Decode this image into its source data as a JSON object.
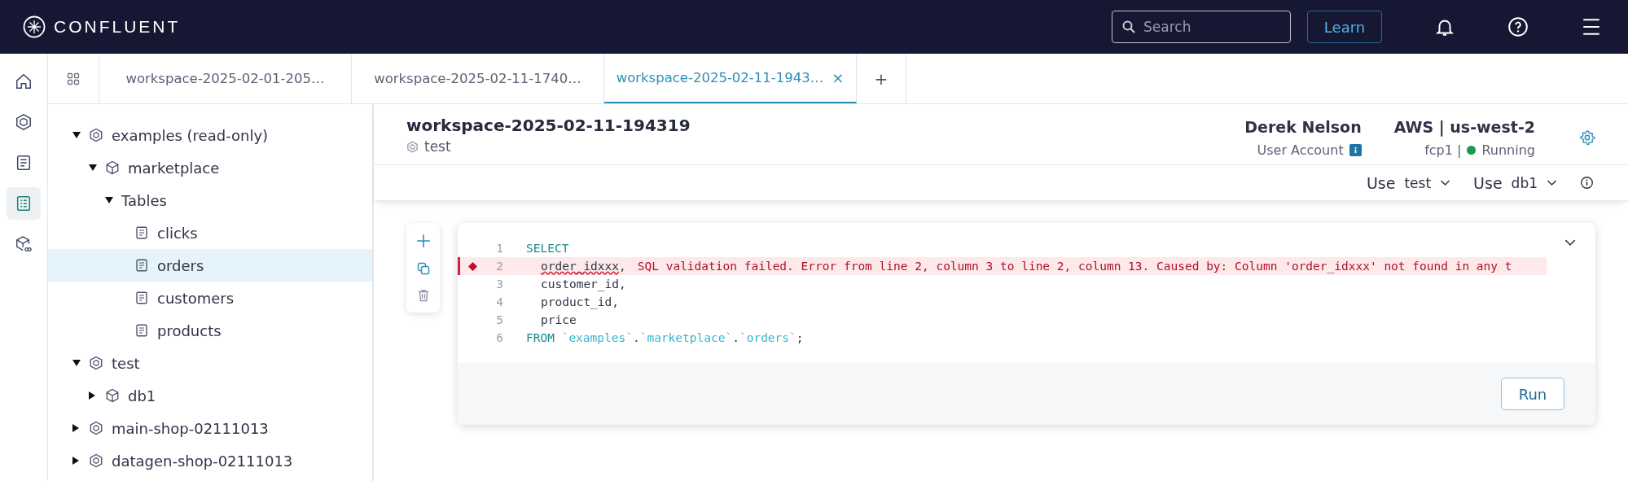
{
  "header": {
    "brand": "CONFLUENT",
    "search": {
      "placeholder": "Search"
    },
    "learn": "Learn"
  },
  "rail": [
    {
      "kind": "home",
      "selected": false
    },
    {
      "kind": "environment",
      "selected": false
    },
    {
      "kind": "document",
      "selected": false
    },
    {
      "kind": "workspace",
      "selected": true
    },
    {
      "kind": "compute",
      "selected": false
    }
  ],
  "tabs": [
    {
      "label": "workspace-2025-02-01-205…",
      "selected": false
    },
    {
      "label": "workspace-2025-02-11-1740…",
      "selected": false
    },
    {
      "label": "workspace-2025-02-11-1943…",
      "selected": true,
      "close": "×"
    }
  ],
  "add_tab": "+",
  "tree": [
    {
      "label": "examples (read-only)",
      "kind": "catalog",
      "expanded": true,
      "selected": false,
      "children": [
        {
          "label": "marketplace",
          "kind": "database",
          "expanded": true,
          "selected": false,
          "children": [
            {
              "label": "Tables",
              "kind": "folder",
              "expanded": true,
              "selected": false,
              "children": [
                {
                  "label": "clicks",
                  "kind": "table",
                  "selected": false
                },
                {
                  "label": "orders",
                  "kind": "table",
                  "selected": true
                },
                {
                  "label": "customers",
                  "kind": "table",
                  "selected": false
                },
                {
                  "label": "products",
                  "kind": "table",
                  "selected": false
                }
              ]
            }
          ]
        }
      ]
    },
    {
      "label": "test",
      "kind": "catalog",
      "expanded": true,
      "selected": false,
      "children": [
        {
          "label": "db1",
          "kind": "database",
          "expanded": false,
          "selected": false
        }
      ]
    },
    {
      "label": "main-shop-02111013",
      "kind": "catalog",
      "expanded": false,
      "selected": false
    },
    {
      "label": "datagen-shop-02111013",
      "kind": "catalog",
      "expanded": false,
      "selected": false
    }
  ],
  "workspace": {
    "title": "workspace-2025-02-11-194319",
    "catalog": "test",
    "user": {
      "name": "Derek Nelson",
      "account": "User Account"
    },
    "cluster": {
      "cloud": "AWS | us-west-2",
      "pool": "fcp1 |",
      "status": "Running",
      "color": "#1a9a4c"
    },
    "use": [
      {
        "label": "Use",
        "value": "test"
      },
      {
        "label": "Use",
        "value": "db1"
      }
    ]
  },
  "editor": {
    "lines": [
      {
        "number": "1",
        "error": false,
        "tokens": [
          {
            "kind": "keyword",
            "text": "SELECT"
          }
        ]
      },
      {
        "number": "2",
        "error": true,
        "tokens": [
          {
            "kind": "squiggle",
            "text": "order_idxxx"
          },
          {
            "kind": "ident",
            "text": ","
          },
          {
            "kind": "message",
            "text": "SQL validation failed. Error from line 2, column 3 to line 2, column 13. Caused by: Column 'order_idxxx' not found in any t"
          }
        ]
      },
      {
        "number": "3",
        "error": false,
        "tokens": [
          {
            "kind": "ident",
            "text": "customer_id,"
          }
        ]
      },
      {
        "number": "4",
        "error": false,
        "tokens": [
          {
            "kind": "ident",
            "text": "product_id,"
          }
        ]
      },
      {
        "number": "5",
        "error": false,
        "tokens": [
          {
            "kind": "ident",
            "text": "price"
          }
        ]
      },
      {
        "number": "6",
        "error": false,
        "tokens": [
          {
            "kind": "keyword",
            "text": "FROM "
          },
          {
            "kind": "string",
            "text": "`examples`"
          },
          {
            "kind": "ident",
            "text": "."
          },
          {
            "kind": "string",
            "text": "`marketplace`"
          },
          {
            "kind": "ident",
            "text": "."
          },
          {
            "kind": "string",
            "text": "`orders`"
          },
          {
            "kind": "ident",
            "text": ";"
          }
        ]
      }
    ],
    "run": "Run"
  }
}
